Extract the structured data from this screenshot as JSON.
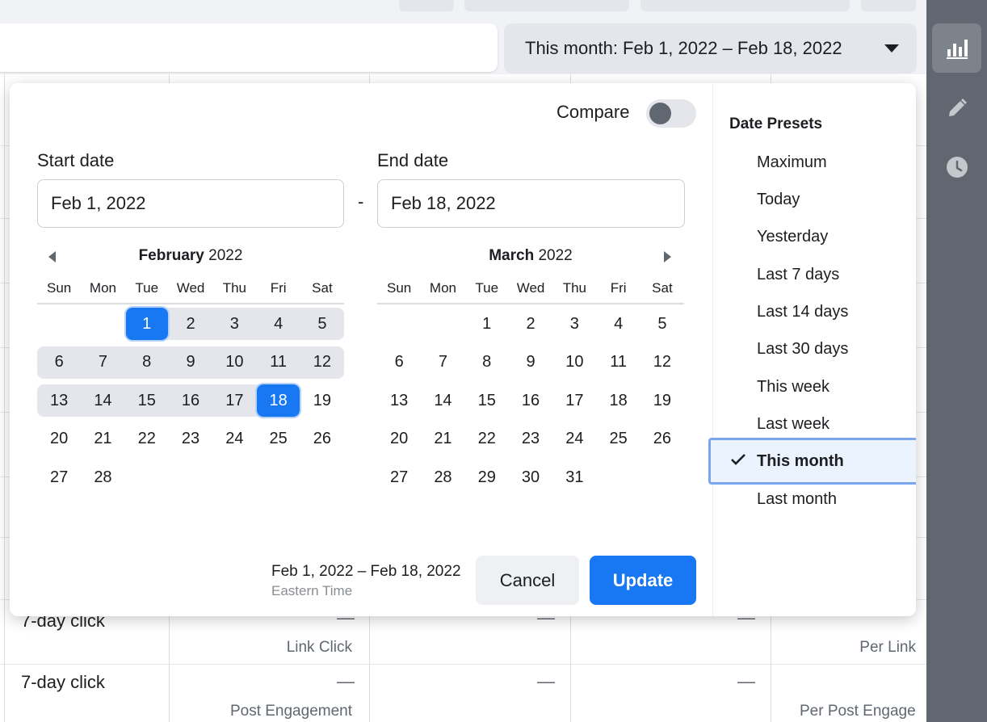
{
  "header": {
    "date_range_button": "This month: Feb 1, 2022 – Feb 18, 2022"
  },
  "background_table": {
    "rows": [
      {
        "label": "7-day click",
        "sublabel_left": "Link Click",
        "sublabel_right": "Per Link",
        "dash": "—"
      },
      {
        "label": "7-day click",
        "sublabel_left": "Post Engagement",
        "sublabel_right": "Per Post Engage",
        "dash": "—"
      }
    ]
  },
  "date_picker": {
    "compare_label": "Compare",
    "compare_on": false,
    "start_label": "Start date",
    "end_label": "End date",
    "start_value": "Feb 1, 2022",
    "end_value": "Feb 18, 2022",
    "separator": "-",
    "weekdays": [
      "Sun",
      "Mon",
      "Tue",
      "Wed",
      "Thu",
      "Fri",
      "Sat"
    ],
    "calendars": [
      {
        "month": "February",
        "year": "2022",
        "weeks": [
          [
            "",
            "",
            "1",
            "2",
            "3",
            "4",
            "5"
          ],
          [
            "6",
            "7",
            "8",
            "9",
            "10",
            "11",
            "12"
          ],
          [
            "13",
            "14",
            "15",
            "16",
            "17",
            "18",
            "19"
          ],
          [
            "20",
            "21",
            "22",
            "23",
            "24",
            "25",
            "26"
          ],
          [
            "27",
            "28",
            "",
            "",
            "",
            "",
            ""
          ]
        ]
      },
      {
        "month": "March",
        "year": "2022",
        "weeks": [
          [
            "",
            "",
            "1",
            "2",
            "3",
            "4",
            "5"
          ],
          [
            "6",
            "7",
            "8",
            "9",
            "10",
            "11",
            "12"
          ],
          [
            "13",
            "14",
            "15",
            "16",
            "17",
            "18",
            "19"
          ],
          [
            "20",
            "21",
            "22",
            "23",
            "24",
            "25",
            "26"
          ],
          [
            "27",
            "28",
            "29",
            "30",
            "31",
            "",
            ""
          ]
        ]
      }
    ],
    "selected_start_day": "1",
    "selected_end_day": "18",
    "footer_range": "Feb 1, 2022 – Feb 18, 2022",
    "footer_timezone": "Eastern Time",
    "cancel_label": "Cancel",
    "update_label": "Update",
    "accent_color": "#1877f2"
  },
  "presets": {
    "title": "Date Presets",
    "items": [
      "Maximum",
      "Today",
      "Yesterday",
      "Last 7 days",
      "Last 14 days",
      "Last 30 days",
      "This week",
      "Last week",
      "This month",
      "Last month"
    ],
    "active": "This month"
  },
  "right_rail": {
    "icons": [
      "bar-chart-icon",
      "pencil-icon",
      "clock-icon"
    ]
  }
}
